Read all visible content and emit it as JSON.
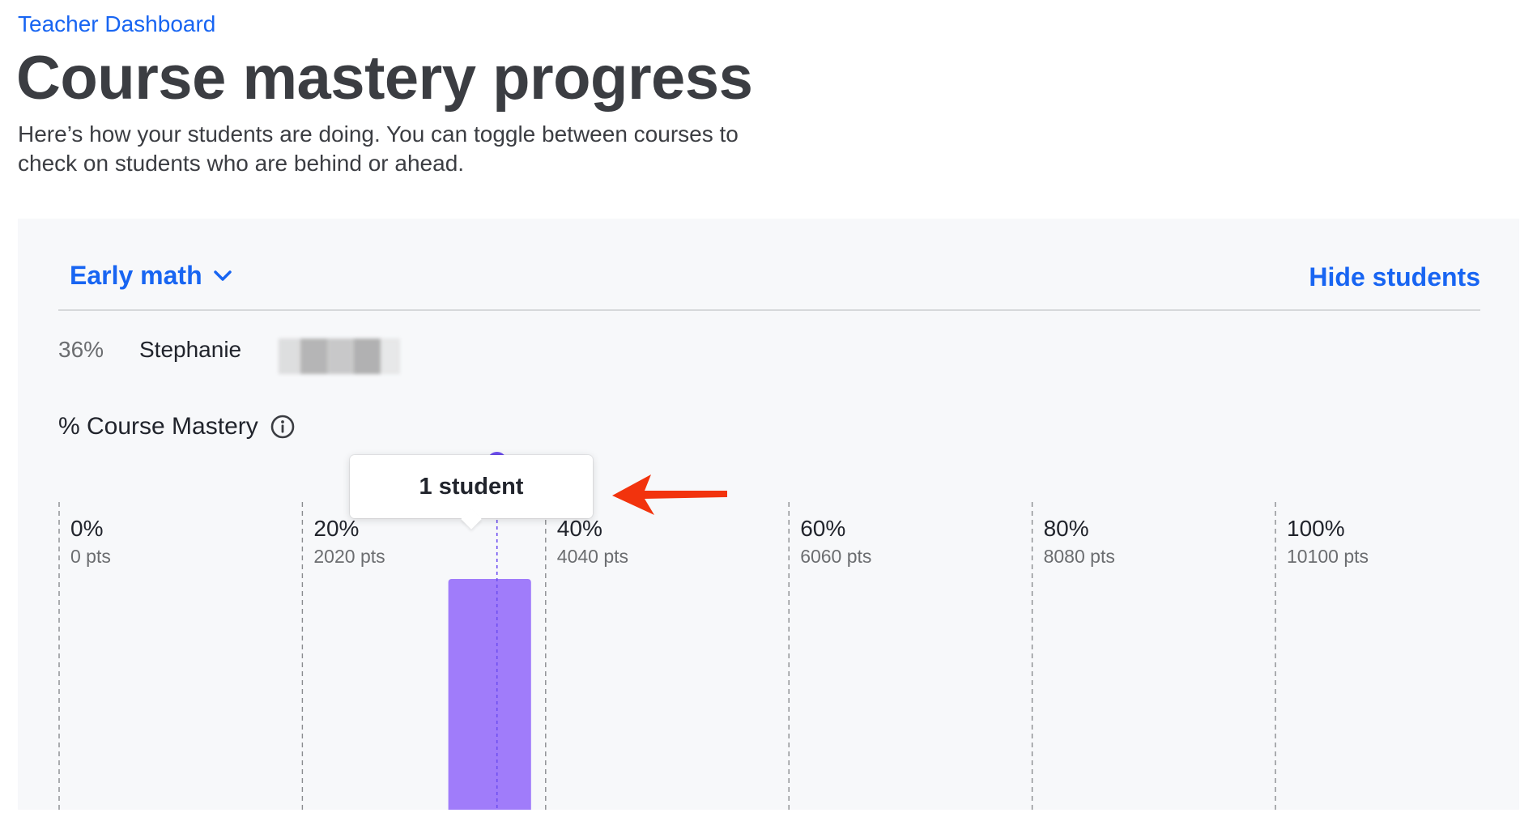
{
  "breadcrumb": "Teacher Dashboard",
  "title": "Course mastery progress",
  "description": "Here’s how your students are doing. You can toggle between courses to check on students who are behind or ahead.",
  "course_selector": {
    "label": "Early math",
    "icon": "chevron-down-icon"
  },
  "hide_students_label": "Hide students",
  "students": [
    {
      "percent": "36%",
      "name": "Stephanie"
    }
  ],
  "mastery_label": "% Course Mastery",
  "info_icon": "info-icon",
  "tooltip": "1 student",
  "colors": {
    "link": "#1865f2",
    "bar": "#a07cfa",
    "marker": "#6e4ff0",
    "annotation": "#f2330d"
  },
  "chart_data": {
    "type": "bar",
    "title": "% Course Mastery",
    "ticks": [
      {
        "label": "0%",
        "sublabel": "0 pts",
        "value": 0
      },
      {
        "label": "20%",
        "sublabel": "2020 pts",
        "value": 20
      },
      {
        "label": "40%",
        "sublabel": "4040 pts",
        "value": 40
      },
      {
        "label": "60%",
        "sublabel": "6060 pts",
        "value": 60
      },
      {
        "label": "80%",
        "sublabel": "8080 pts",
        "value": 80
      },
      {
        "label": "100%",
        "sublabel": "10100 pts",
        "value": 100
      }
    ],
    "xlim": [
      0,
      100
    ],
    "bins": [
      {
        "start": 30,
        "end": 40,
        "count": 1
      }
    ],
    "highlight_value": 36,
    "grid": true
  }
}
